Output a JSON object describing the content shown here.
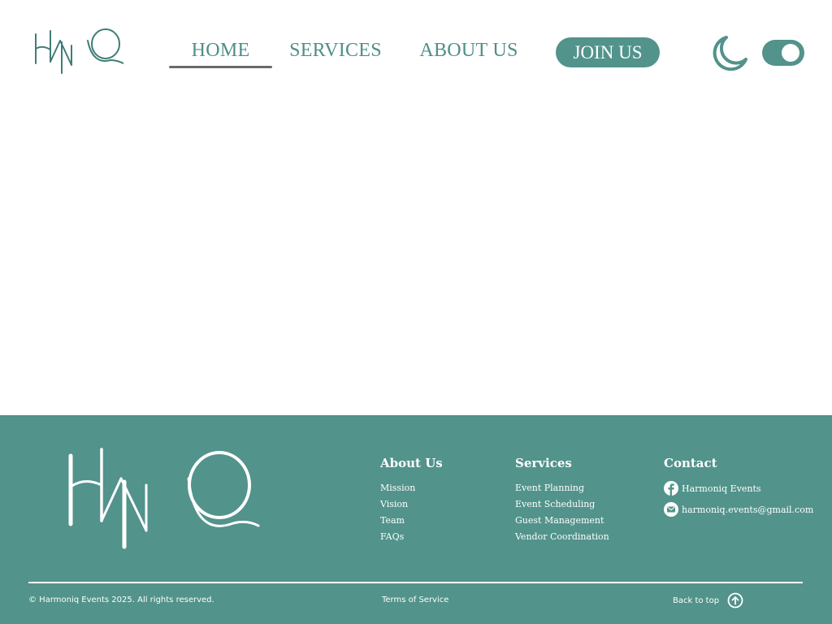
{
  "brand": {
    "logo_text": "HMQ",
    "accent_color": "#52938b",
    "nav_text_color": "#4f8f88"
  },
  "header": {
    "nav": [
      {
        "label": "HOME",
        "active": true
      },
      {
        "label": "SERVICES",
        "active": false
      },
      {
        "label": "ABOUT US",
        "active": false
      }
    ],
    "join_label": "JOIN US",
    "theme_icon": "moon-icon",
    "theme_toggle_on": true
  },
  "footer": {
    "about": {
      "title": "About Us",
      "links": [
        "Mission",
        "Vision",
        "Team",
        "FAQs"
      ]
    },
    "services": {
      "title": "Services",
      "links": [
        "Event Planning",
        "Event Scheduling",
        "Guest Management",
        "Vendor Coordination"
      ]
    },
    "contact": {
      "title": "Contact",
      "facebook": "Harmoniq Events",
      "facebook_icon": "facebook-icon",
      "email": "harmoniq.events@gmail.com",
      "email_icon": "mail-icon"
    },
    "copyright": "© Harmoniq Events 2025. All rights reserved.",
    "terms": "Terms of Service",
    "back_to_top": "Back to top",
    "back_to_top_icon": "arrow-up-circle-icon"
  }
}
